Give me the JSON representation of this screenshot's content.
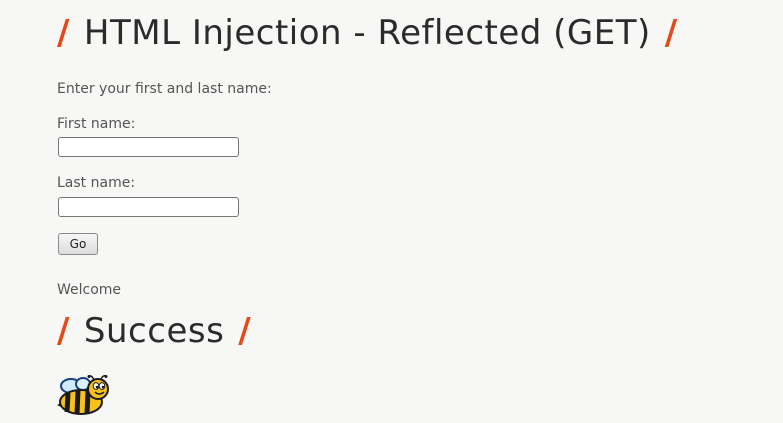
{
  "page": {
    "title_slash_left": "/",
    "title": "HTML Injection - Reflected (GET)",
    "title_slash_right": "/",
    "intro": "Enter your first and last name:"
  },
  "form": {
    "first_name_label": "First name:",
    "first_name_value": "",
    "last_name_label": "Last name:",
    "last_name_value": "",
    "submit_label": "Go"
  },
  "result": {
    "message": "Welcome"
  },
  "success": {
    "slash_left": "/",
    "title": "Success",
    "slash_right": "/"
  },
  "colors": {
    "accent": "#e34a18",
    "background": "#f7f7f6",
    "heading": "#2b2b2b"
  },
  "icons": {
    "mascot": "bee-icon"
  }
}
